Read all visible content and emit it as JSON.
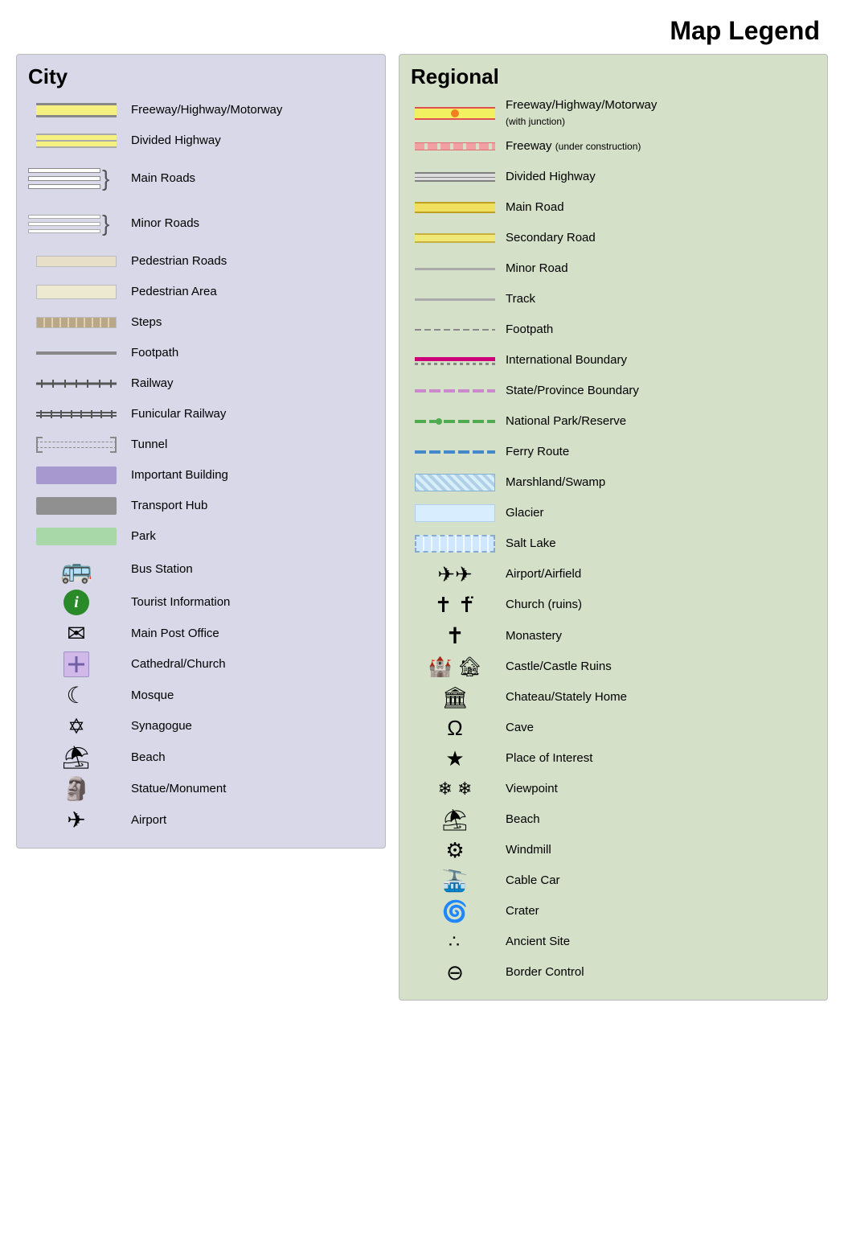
{
  "title": "Map Legend",
  "city": {
    "heading": "City",
    "items": [
      {
        "label": "Freeway/Highway/Motorway",
        "symbol": "freeway"
      },
      {
        "label": "Divided Highway",
        "symbol": "divided-highway"
      },
      {
        "label": "Main Roads",
        "symbol": "main-roads"
      },
      {
        "label": "Minor Roads",
        "symbol": "minor-roads"
      },
      {
        "label": "Pedestrian Roads",
        "symbol": "pedestrian-roads"
      },
      {
        "label": "Pedestrian Area",
        "symbol": "pedestrian-area"
      },
      {
        "label": "Steps",
        "symbol": "steps"
      },
      {
        "label": "Footpath",
        "symbol": "footpath"
      },
      {
        "label": "Railway",
        "symbol": "railway"
      },
      {
        "label": "Funicular Railway",
        "symbol": "funicular"
      },
      {
        "label": "Tunnel",
        "symbol": "tunnel"
      },
      {
        "label": "Important Building",
        "symbol": "important-building"
      },
      {
        "label": "Transport Hub",
        "symbol": "transport-hub"
      },
      {
        "label": "Park",
        "symbol": "park"
      },
      {
        "label": "Bus Station",
        "symbol": "bus-station"
      },
      {
        "label": "Tourist Information",
        "symbol": "tourist-info"
      },
      {
        "label": "Main Post Office",
        "symbol": "post-office"
      },
      {
        "label": "Cathedral/Church",
        "symbol": "cathedral"
      },
      {
        "label": "Mosque",
        "symbol": "mosque"
      },
      {
        "label": "Synagogue",
        "symbol": "synagogue"
      },
      {
        "label": "Beach",
        "symbol": "beach-city"
      },
      {
        "label": "Statue/Monument",
        "symbol": "statue"
      },
      {
        "label": "Airport",
        "symbol": "airport-city"
      }
    ]
  },
  "regional": {
    "heading": "Regional",
    "items": [
      {
        "label": "Freeway/Highway/Motorway",
        "sublabel": "(with junction)",
        "symbol": "reg-freeway"
      },
      {
        "label": "Freeway",
        "sublabel": "(under construction)",
        "symbol": "reg-freeway-construction"
      },
      {
        "label": "Divided Highway",
        "symbol": "reg-divided"
      },
      {
        "label": "Main Road",
        "symbol": "reg-main-road"
      },
      {
        "label": "Secondary Road",
        "symbol": "reg-secondary"
      },
      {
        "label": "Minor Road",
        "symbol": "reg-minor"
      },
      {
        "label": "Track",
        "symbol": "reg-track"
      },
      {
        "label": "Footpath",
        "symbol": "reg-footpath"
      },
      {
        "label": "International Boundary",
        "symbol": "reg-intl-boundary"
      },
      {
        "label": "State/Province Boundary",
        "symbol": "reg-state-boundary"
      },
      {
        "label": "National Park/Reserve",
        "symbol": "reg-natpark"
      },
      {
        "label": "Ferry Route",
        "symbol": "reg-ferry"
      },
      {
        "label": "Marshland/Swamp",
        "symbol": "reg-marsh"
      },
      {
        "label": "Glacier",
        "symbol": "reg-glacier"
      },
      {
        "label": "Salt Lake",
        "symbol": "reg-saltlake"
      },
      {
        "label": "Airport/Airfield",
        "symbol": "reg-airport"
      },
      {
        "label": "Church (ruins)",
        "symbol": "reg-church"
      },
      {
        "label": "Monastery",
        "symbol": "reg-monastery"
      },
      {
        "label": "Castle/Castle Ruins",
        "symbol": "reg-castle"
      },
      {
        "label": "Chateau/Stately Home",
        "symbol": "reg-chateau"
      },
      {
        "label": "Cave",
        "symbol": "reg-cave"
      },
      {
        "label": "Place of Interest",
        "symbol": "reg-poi"
      },
      {
        "label": "Viewpoint",
        "symbol": "reg-viewpoint"
      },
      {
        "label": "Beach",
        "symbol": "reg-beach"
      },
      {
        "label": "Windmill",
        "symbol": "reg-windmill"
      },
      {
        "label": "Cable Car",
        "symbol": "reg-cablecar"
      },
      {
        "label": "Crater",
        "symbol": "reg-crater"
      },
      {
        "label": "Ancient Site",
        "symbol": "reg-ancient"
      },
      {
        "label": "Border Control",
        "symbol": "reg-border"
      }
    ]
  }
}
